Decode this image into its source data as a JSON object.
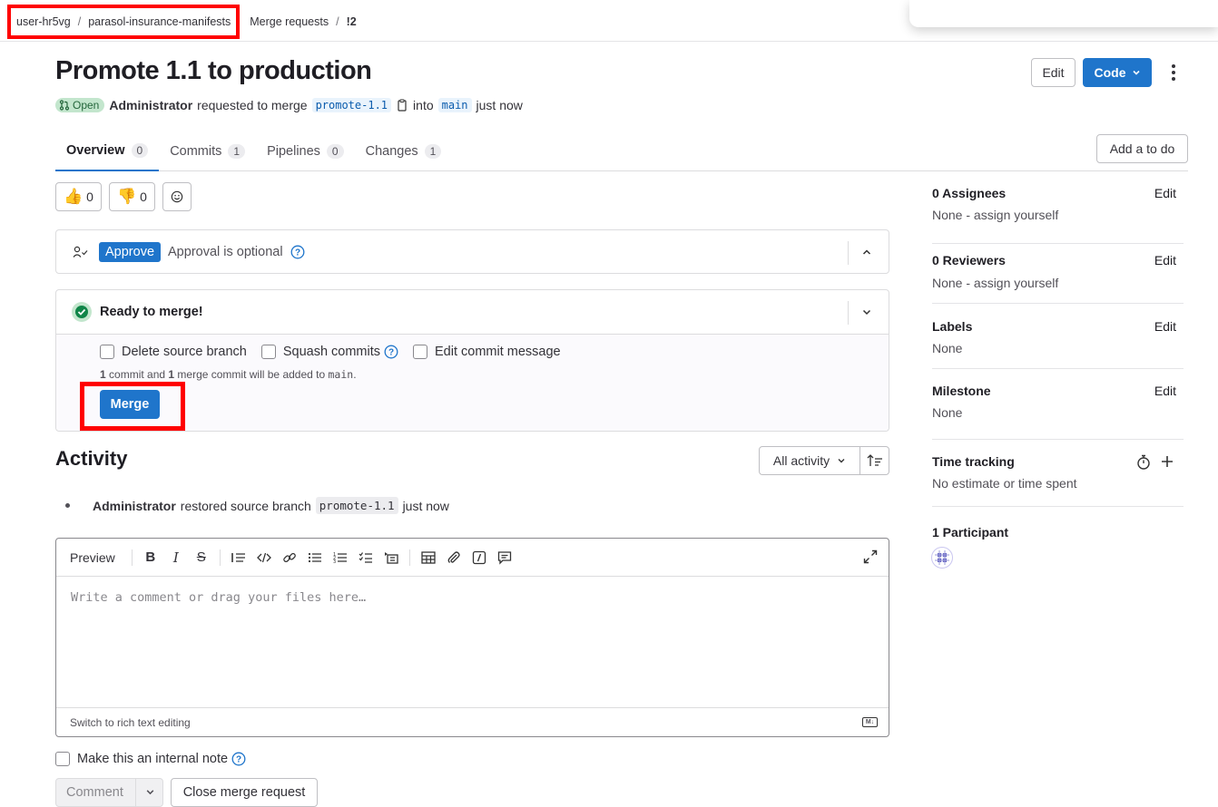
{
  "breadcrumb": {
    "items": [
      "user-hr5vg",
      "parasol-insurance-manifests",
      "Merge requests",
      "!2"
    ],
    "separator": "/"
  },
  "mr": {
    "title": "Promote 1.1 to production",
    "status": "Open",
    "author": "Administrator",
    "action_text": "requested to merge",
    "source_branch": "promote-1.1",
    "into_text": "into",
    "target_branch": "main",
    "time": "just now"
  },
  "header_buttons": {
    "edit": "Edit",
    "code": "Code"
  },
  "tabs": [
    {
      "label": "Overview",
      "count": "0"
    },
    {
      "label": "Commits",
      "count": "1"
    },
    {
      "label": "Pipelines",
      "count": "0"
    },
    {
      "label": "Changes",
      "count": "1"
    }
  ],
  "add_todo": "Add a to do",
  "reactions": {
    "thumbs_up": "0",
    "thumbs_down": "0"
  },
  "approval": {
    "button": "Approve",
    "text": "Approval is optional"
  },
  "merge_widget": {
    "status": "Ready to merge!",
    "options": [
      "Delete source branch",
      "Squash commits",
      "Edit commit message"
    ],
    "note_a": "1",
    "note_b": " commit and ",
    "note_c": "1",
    "note_d": " merge commit will be added to ",
    "note_branch": "main",
    "note_end": ".",
    "merge_button": "Merge"
  },
  "activity": {
    "heading": "Activity",
    "filter": "All activity",
    "event_author": "Administrator",
    "event_text": "restored source branch",
    "event_branch": "promote-1.1",
    "event_time": "just now"
  },
  "editor": {
    "preview": "Preview",
    "placeholder": "Write a comment or drag your files here…",
    "switch_text": "Switch to rich text editing",
    "md_badge": "M↓"
  },
  "internal_note": "Make this an internal note",
  "comment_button": "Comment",
  "close_button": "Close merge request",
  "sidebar": {
    "assignees": {
      "title": "0 Assignees",
      "value": "None - assign yourself",
      "edit": "Edit"
    },
    "reviewers": {
      "title": "0 Reviewers",
      "value": "None - assign yourself",
      "edit": "Edit"
    },
    "labels": {
      "title": "Labels",
      "value": "None",
      "edit": "Edit"
    },
    "milestone": {
      "title": "Milestone",
      "value": "None",
      "edit": "Edit"
    },
    "time_tracking": {
      "title": "Time tracking",
      "value": "No estimate or time spent"
    },
    "participants": {
      "title": "1 Participant"
    }
  },
  "colors": {
    "accent": "#1f75cb",
    "success": "#108548",
    "highlight": "#ff0000"
  }
}
